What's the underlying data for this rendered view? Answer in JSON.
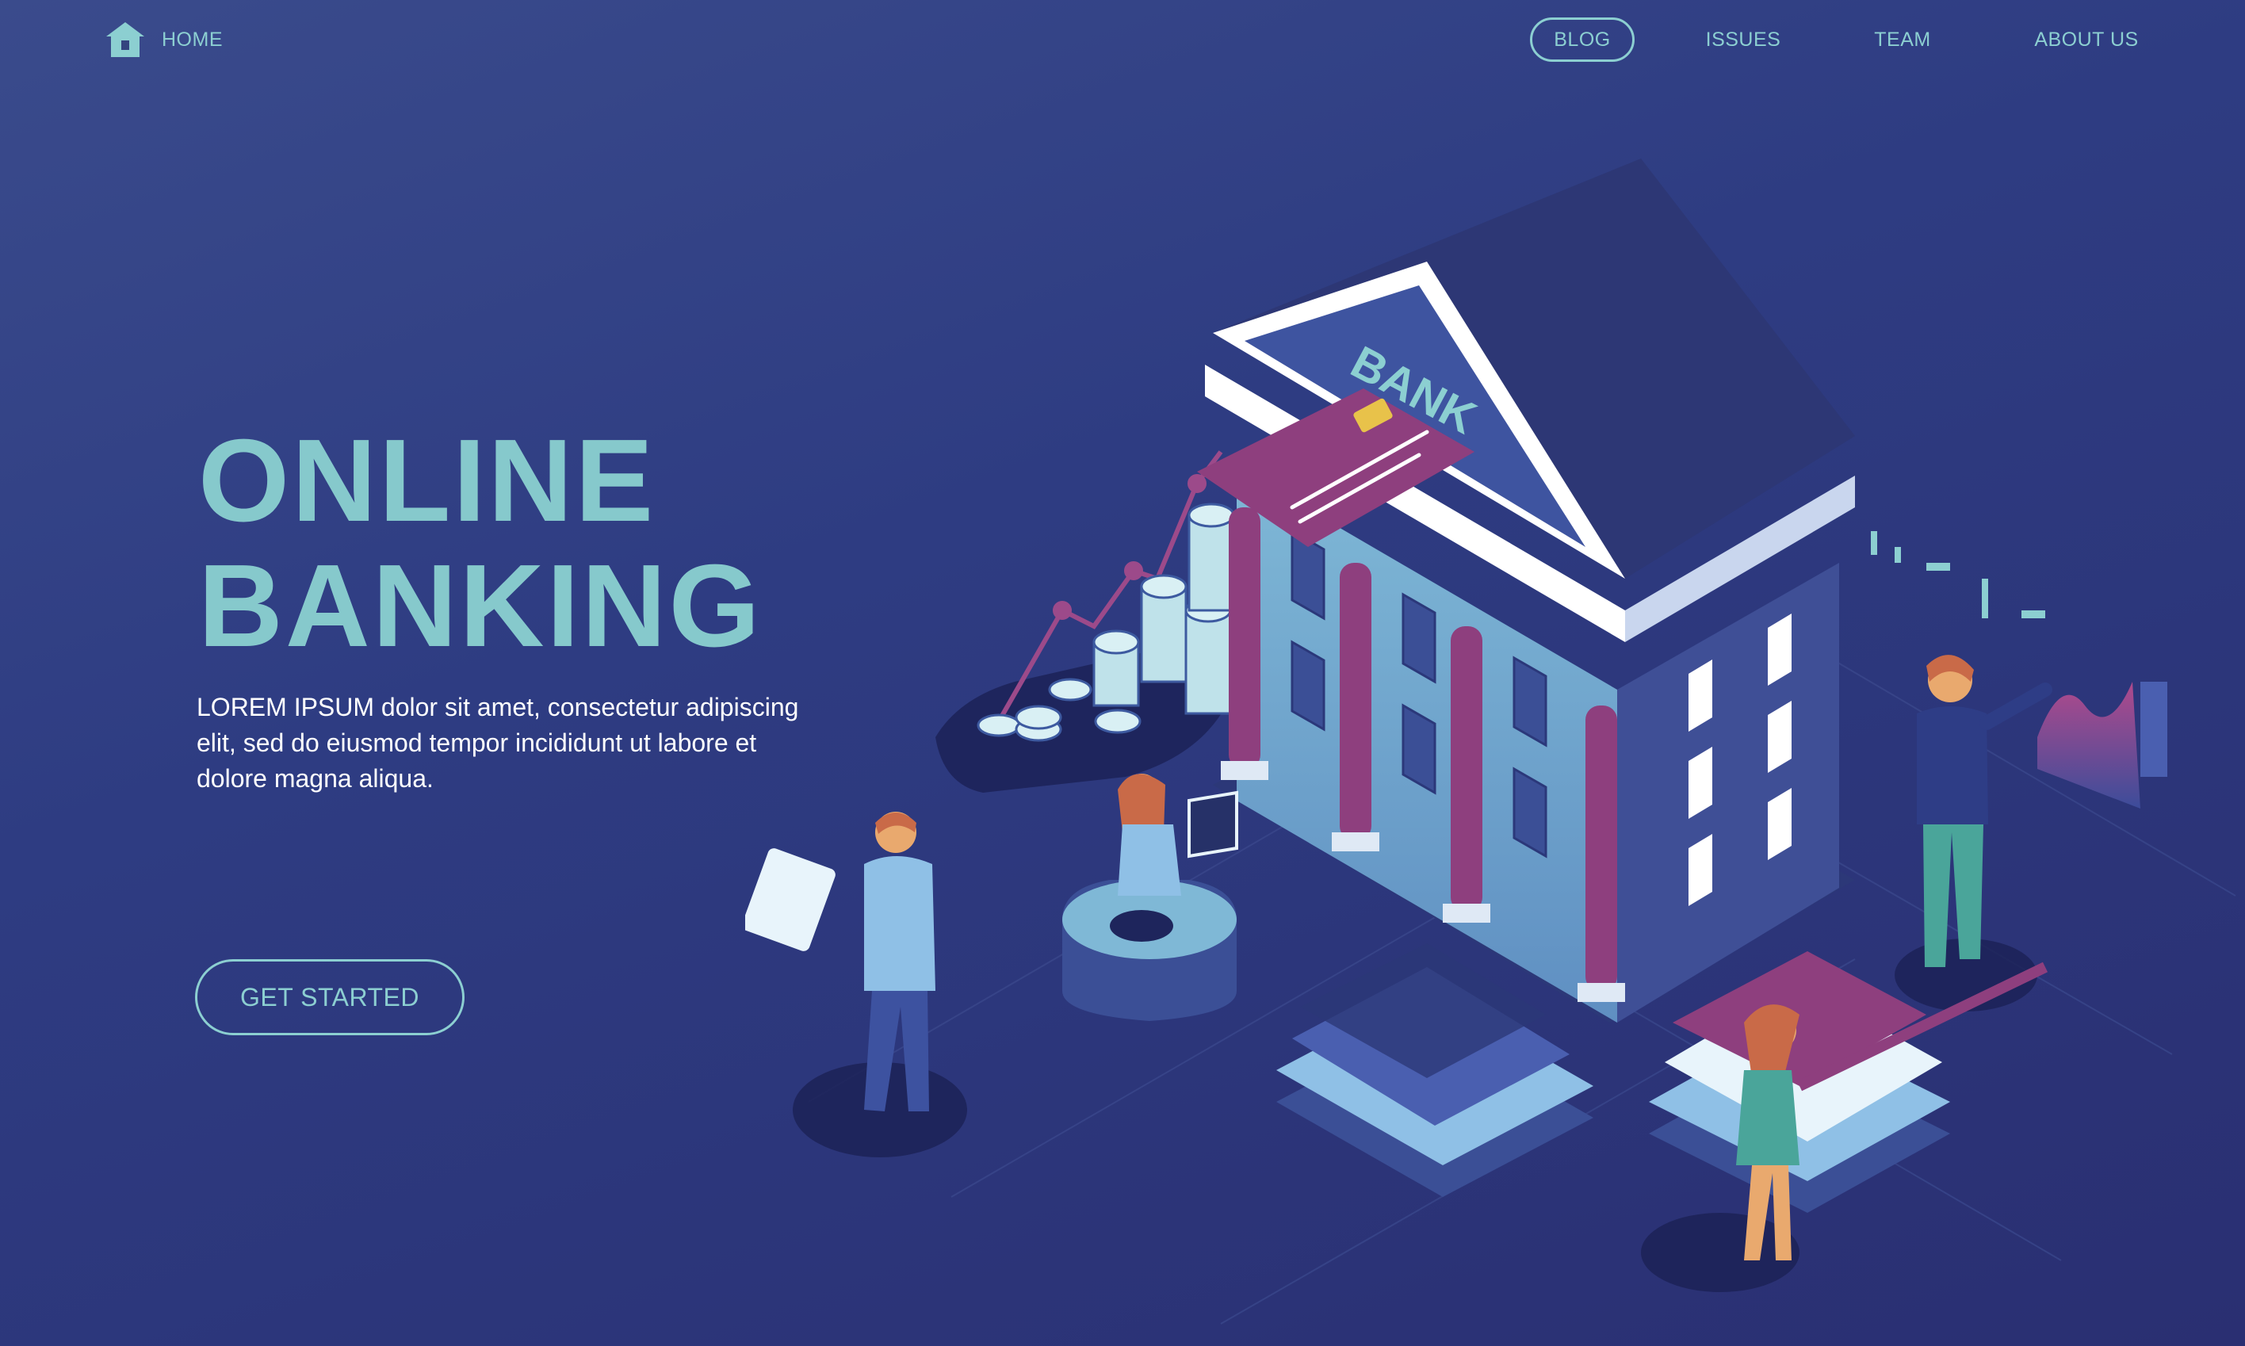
{
  "nav": {
    "home_label": "HOME",
    "links": [
      {
        "label": "BLOG",
        "active": true
      },
      {
        "label": "ISSUES",
        "active": false
      },
      {
        "label": "TEAM",
        "active": false
      },
      {
        "label": "ABOUT US",
        "active": false
      }
    ]
  },
  "hero": {
    "title_line1": "ONLINE",
    "title_line2": "BANKING",
    "description": "LOREM IPSUM dolor sit amet, consectetur adipiscing elit, sed do eiusmod tempor incididunt ut labore et dolore magna aliqua.",
    "cta_label": "GET STARTED"
  },
  "illustration": {
    "bank_sign": "BANK"
  },
  "colors": {
    "background": "#2e3c82",
    "accent": "#86c9cc",
    "purple": "#8e3f7e",
    "text": "#ffffff"
  },
  "icons": {
    "home": "home-icon"
  }
}
